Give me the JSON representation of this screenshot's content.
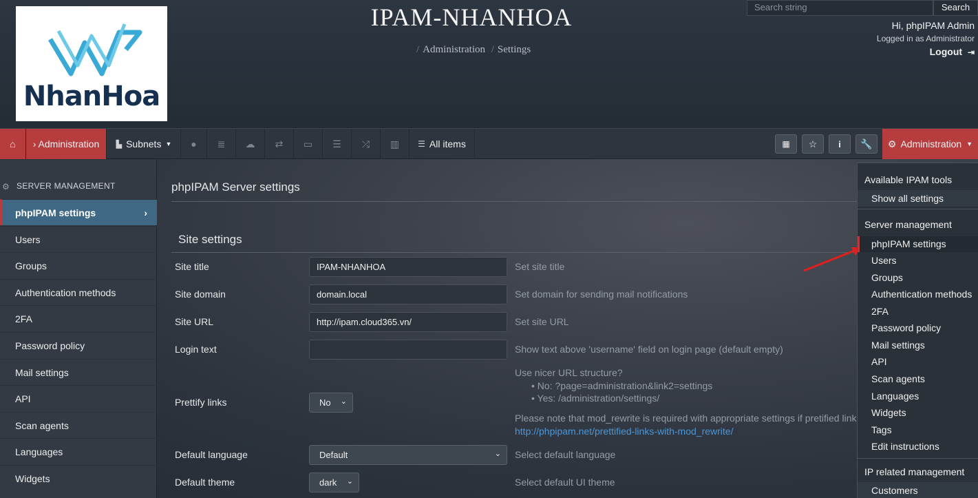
{
  "header": {
    "site_title": "IPAM-NHANHOA",
    "logo_text": "NhanHoa",
    "breadcrumb": [
      "Administration",
      "Settings"
    ],
    "search_placeholder": "Search string",
    "search_button": "Search",
    "user_greeting": "Hi, phpIPAM Admin",
    "logged_in_as": "Logged in as  Administrator",
    "logout_label": "Logout"
  },
  "navbar": {
    "admin_crumb": "› Administration",
    "subnets_label": "Subnets",
    "all_items_label": "All items",
    "admin_menu_label": "Administration"
  },
  "sidebar": {
    "heading": "SERVER MANAGEMENT",
    "items": [
      {
        "label": "phpIPAM settings",
        "active": true
      },
      {
        "label": "Users"
      },
      {
        "label": "Groups"
      },
      {
        "label": "Authentication methods"
      },
      {
        "label": "2FA"
      },
      {
        "label": "Password policy"
      },
      {
        "label": "Mail settings"
      },
      {
        "label": "API"
      },
      {
        "label": "Scan agents"
      },
      {
        "label": "Languages"
      },
      {
        "label": "Widgets"
      }
    ]
  },
  "main": {
    "heading": "phpIPAM Server settings",
    "section": "Site settings",
    "site_title_label": "Site title",
    "site_title_value": "IPAM-NHANHOA",
    "site_title_help": "Set site title",
    "site_domain_label": "Site domain",
    "site_domain_value": "domain.local",
    "site_domain_help": "Set domain for sending mail notifications",
    "site_url_label": "Site URL",
    "site_url_value": "http://ipam.cloud365.vn/",
    "site_url_help": "Set site URL",
    "login_text_label": "Login text",
    "login_text_value": "",
    "login_text_help": "Show text above 'username' field on login page (default empty)",
    "prettify_label": "Prettify links",
    "prettify_value": "No",
    "prettify_help_title": "Use nicer URL structure?",
    "prettify_help_no": "No: ?page=administration&link2=settings",
    "prettify_help_yes": "Yes: /administration/settings/",
    "prettify_note": "Please note that mod_rewrite is required with appropriate settings if pretified links are s",
    "prettify_link": "http://phpipam.net/prettified-links-with-mod_rewrite/",
    "default_language_label": "Default language",
    "default_language_value": "Default",
    "default_language_help": "Select default language",
    "default_theme_label": "Default theme",
    "default_theme_value": "dark",
    "default_theme_help": "Select default UI theme"
  },
  "dropdown": {
    "tools_header": "Available IPAM tools",
    "show_all": "Show all settings",
    "server_header": "Server management",
    "server_items": [
      "phpIPAM settings",
      "Users",
      "Groups",
      "Authentication methods",
      "2FA",
      "Password policy",
      "Mail settings",
      "API",
      "Scan agents",
      "Languages",
      "Widgets",
      "Tags",
      "Edit instructions"
    ],
    "ip_header": "IP related management",
    "ip_items": [
      "Customers"
    ]
  },
  "colors": {
    "accent_red": "#b63c3e",
    "active_blue": "#3f6885",
    "link_blue": "#4a97d8"
  }
}
